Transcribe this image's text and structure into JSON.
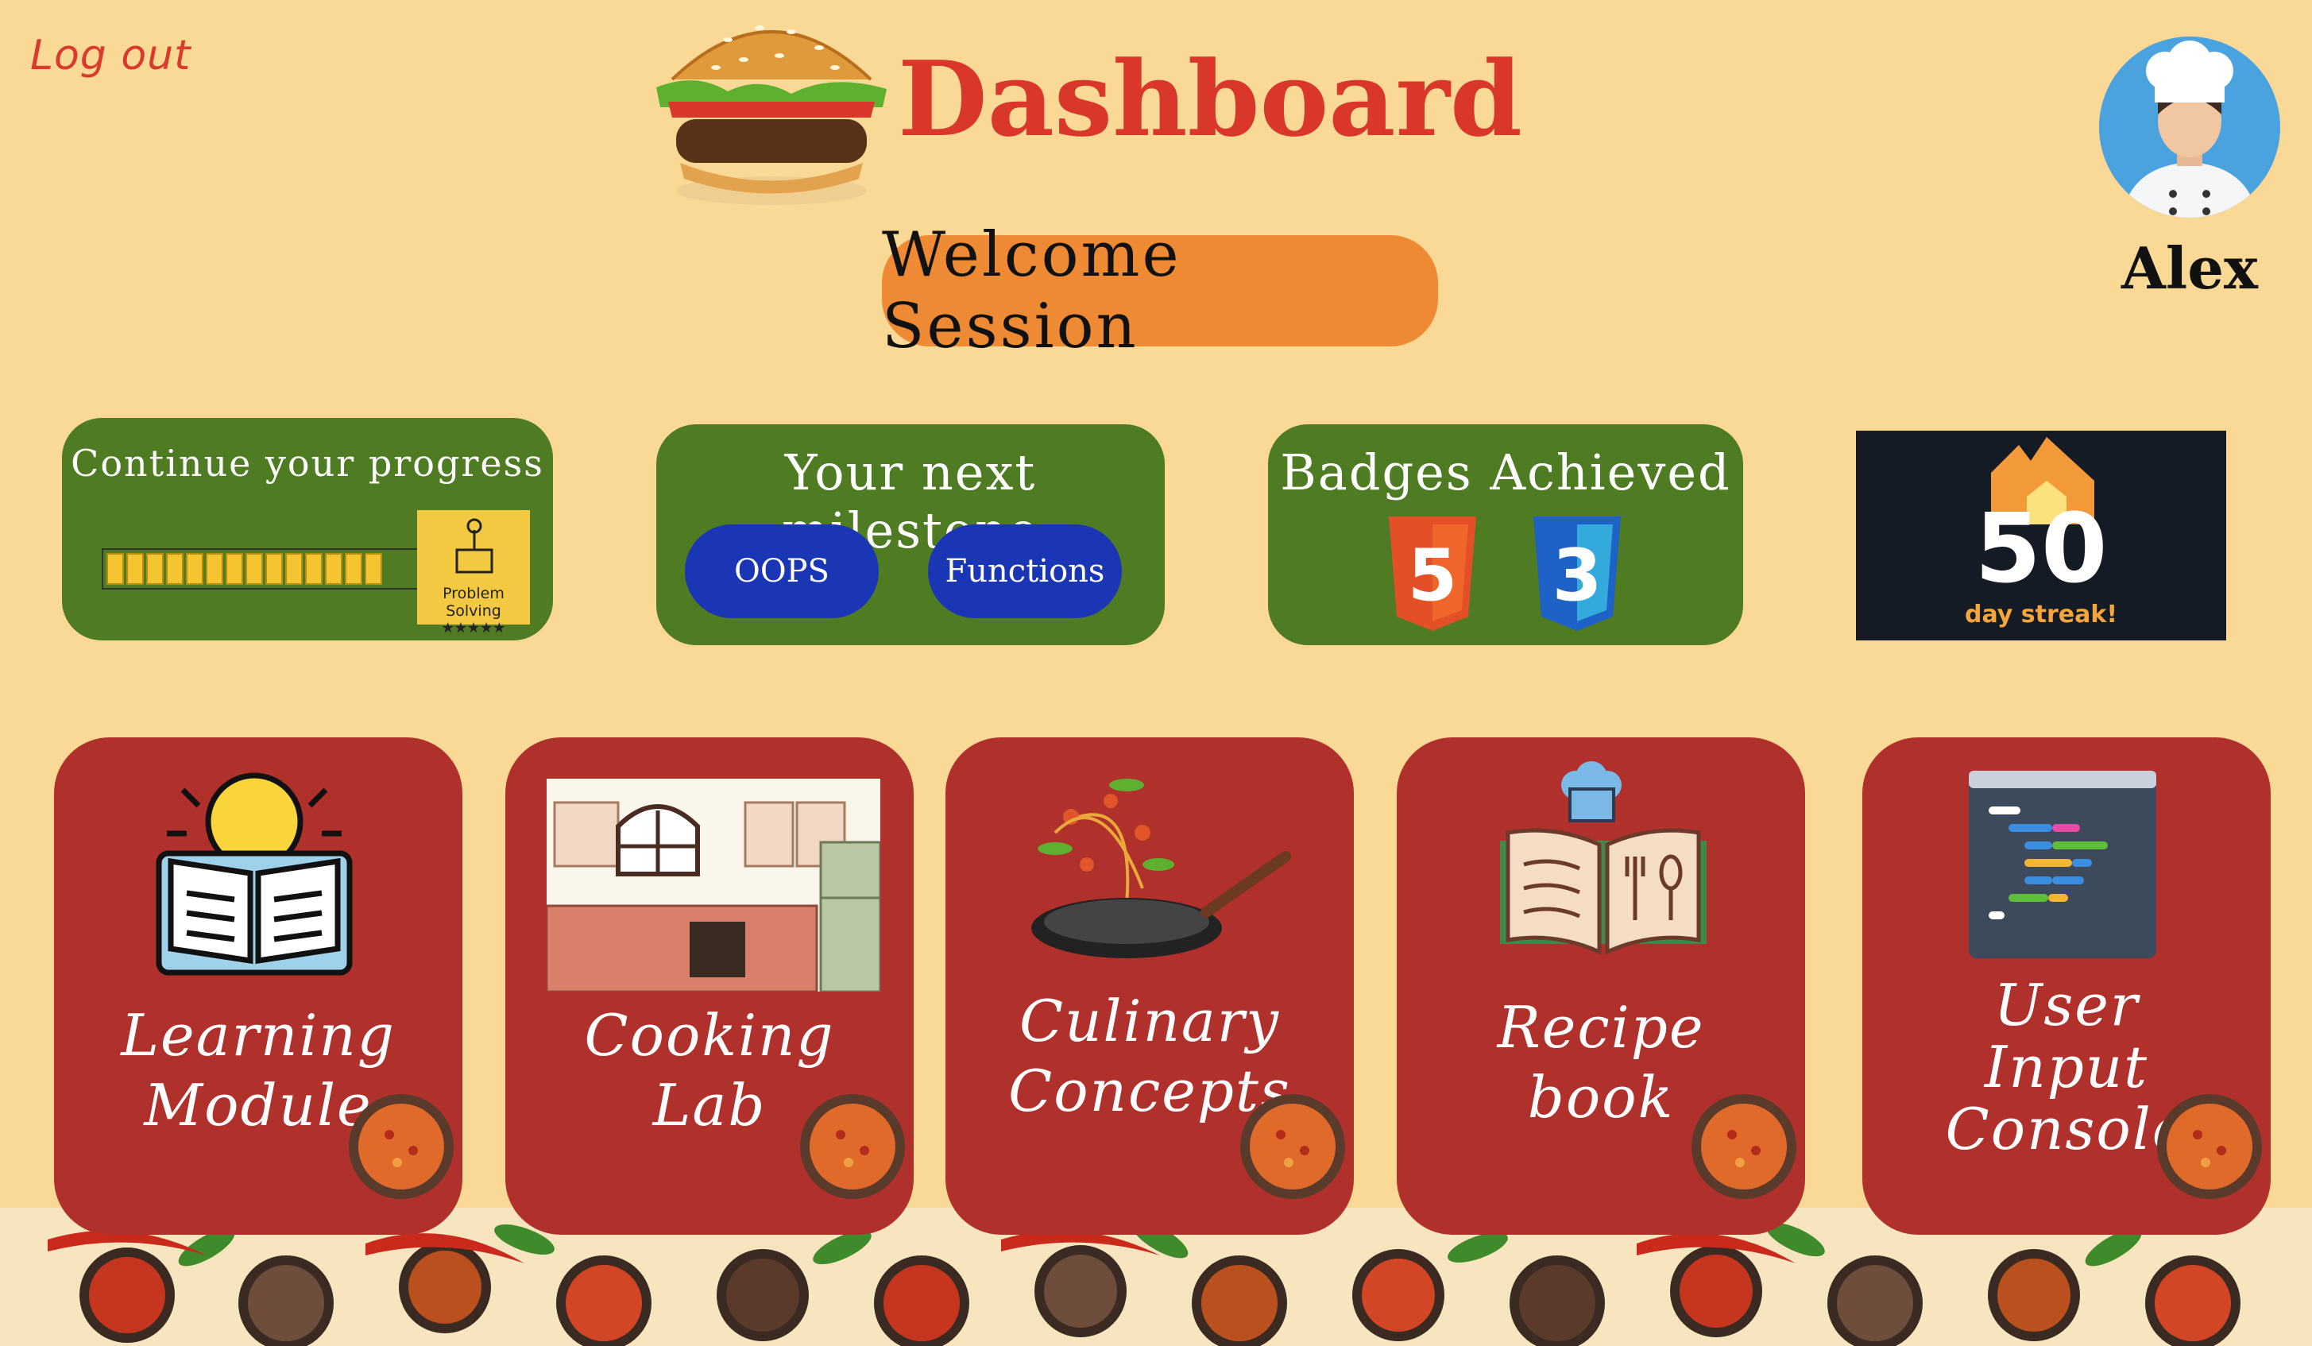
{
  "header": {
    "logout_label": "Log out",
    "title": "Dashboard",
    "welcome_label": "Welcome Session"
  },
  "user": {
    "name": "Alex"
  },
  "progress_card": {
    "title": "Continue your progress",
    "progress_fraction": 0.82,
    "badge_label": "Problem Solving",
    "badge_stars": "★★★★★"
  },
  "milestone_card": {
    "title": "Your next milestone",
    "items": [
      "OOPS",
      "Functions"
    ]
  },
  "badges_card": {
    "title": "Badges Achieved",
    "badges": [
      {
        "icon": "html5-icon",
        "glyph": "5",
        "color": "#e34f26"
      },
      {
        "icon": "css3-icon",
        "glyph": "3",
        "color": "#2962c9"
      }
    ]
  },
  "streak": {
    "count": "50",
    "label": "day streak!",
    "color": "#f5a53a"
  },
  "tiles": [
    {
      "line1": "Learning",
      "line2": "Module",
      "line3": "",
      "icon": "idea-book-icon"
    },
    {
      "line1": "Cooking",
      "line2": "Lab",
      "line3": "",
      "icon": "kitchen-icon"
    },
    {
      "line1": "Culinary",
      "line2": "Concepts",
      "line3": "",
      "icon": "frying-pan-icon"
    },
    {
      "line1": "Recipe",
      "line2": "book",
      "line3": "",
      "icon": "recipe-book-icon"
    },
    {
      "line1": "User",
      "line2": "Input",
      "line3": "Console",
      "icon": "code-console-icon"
    }
  ],
  "colors": {
    "background": "#f9d995",
    "accent_red": "#d8372a",
    "card_green": "#4f7b23",
    "tile_red": "#b0302c",
    "pill_blue": "#1b36b5",
    "welcome_orange": "#ee8a33"
  }
}
